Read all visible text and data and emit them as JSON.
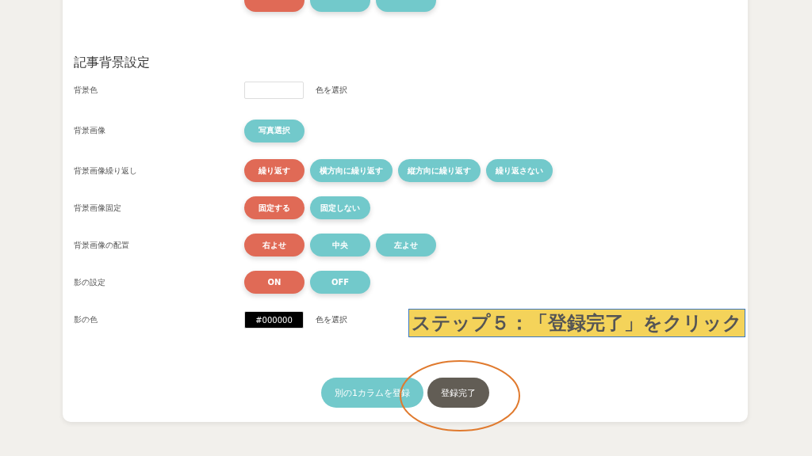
{
  "top_row": {
    "options": [
      {
        "selected": true
      },
      {
        "selected": false
      },
      {
        "selected": false
      }
    ]
  },
  "section_title": "記事背景設定",
  "rows": [
    {
      "kind": "color",
      "label": "背景色",
      "action": "色を選択"
    },
    {
      "kind": "image",
      "label": "背景画像",
      "button": "写真選択"
    },
    {
      "kind": "choice",
      "label": "背景画像繰り返し",
      "options": [
        {
          "label": "繰り返す",
          "selected": true
        },
        {
          "label": "横方向に繰り返す",
          "selected": false
        },
        {
          "label": "縦方向に繰り返す",
          "selected": false
        },
        {
          "label": "繰り返さない",
          "selected": false
        }
      ]
    },
    {
      "kind": "choice",
      "label": "背景画像固定",
      "options": [
        {
          "label": "固定する",
          "selected": true
        },
        {
          "label": "固定しない",
          "selected": false
        }
      ]
    },
    {
      "kind": "choice",
      "label": "背景画像の配置",
      "options": [
        {
          "label": "右よせ",
          "selected": true
        },
        {
          "label": "中央",
          "selected": false
        },
        {
          "label": "左よせ",
          "selected": false
        }
      ]
    },
    {
      "kind": "choice",
      "label": "影の設定",
      "options": [
        {
          "label": "ON",
          "selected": true
        },
        {
          "label": "OFF",
          "selected": false
        }
      ]
    },
    {
      "kind": "color",
      "label": "影の色",
      "value": "#000000",
      "action": "色を選択"
    }
  ],
  "footer_buttons": [
    {
      "label": "別の1カラムを登録",
      "kind": "secondary"
    },
    {
      "label": "登録完了",
      "kind": "primary"
    }
  ],
  "annotation": {
    "text": "ステップ５：「登録完了」をクリック"
  }
}
